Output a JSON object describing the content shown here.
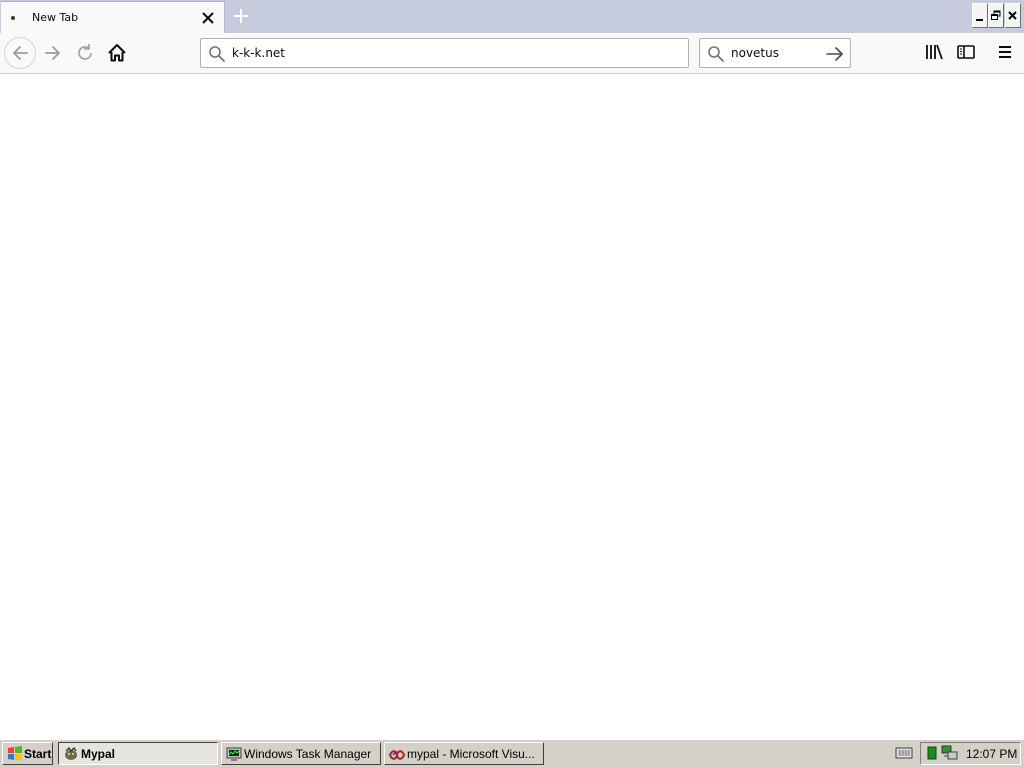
{
  "tabs": [
    {
      "label": "New Tab",
      "active": true
    }
  ],
  "window_controls": {
    "minimize_icon": "minimize-icon",
    "restore_icon": "restore-icon",
    "close_icon": "close-icon"
  },
  "navbar": {
    "url_value": "k-k-k.net",
    "search_value": "novetus",
    "icons": [
      "back-arrow-icon",
      "forward-arrow-icon",
      "reload-icon",
      "home-icon",
      "library-icon",
      "sidebar-icon",
      "hamburger-menu-icon"
    ]
  },
  "taskbar": {
    "start_label": "Start",
    "buttons": [
      {
        "label": "Mypal",
        "active": true,
        "icon": "mypal-icon"
      },
      {
        "label": "Windows Task Manager",
        "active": false,
        "icon": "task-manager-icon"
      },
      {
        "label": "mypal - Microsoft Visu...",
        "active": false,
        "icon": "visual-studio-icon"
      }
    ],
    "clock": "12:07 PM"
  },
  "colors": {
    "tabstrip": "#c6cbdd",
    "toolbar": "#f9f9fa",
    "taskbar": "#d4d0c8"
  }
}
